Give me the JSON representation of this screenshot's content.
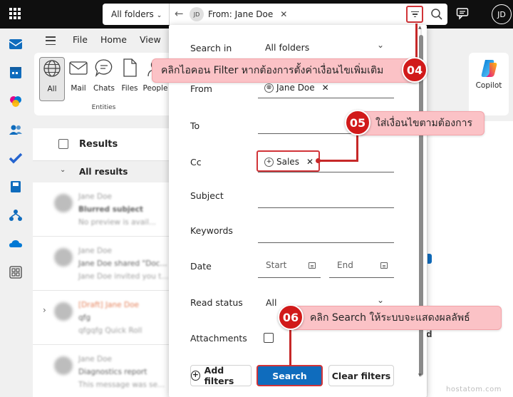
{
  "topbar": {
    "folder_select": "All folders",
    "search_chip": {
      "avatar": "JD",
      "label": "From: Jane Doe"
    },
    "user_avatar": "JD",
    "icons": [
      "waffle-icon",
      "back-arrow-icon",
      "filter-icon",
      "search-icon",
      "chat-icon"
    ]
  },
  "menubar": {
    "items": [
      "File",
      "Home",
      "View"
    ]
  },
  "ribbon": {
    "buttons": [
      {
        "label": "All",
        "icon": "globe-icon",
        "selected": true
      },
      {
        "label": "Mail",
        "icon": "mail-icon"
      },
      {
        "label": "Chats",
        "icon": "chat-bubble-icon"
      },
      {
        "label": "Files",
        "icon": "file-icon"
      },
      {
        "label": "People",
        "icon": "people-icon"
      }
    ],
    "group_label": "Entities",
    "copilot_label": "Copilot"
  },
  "message_list": {
    "results_label": "Results",
    "all_results_label": "All results",
    "items": [
      {
        "sender": "Jane Doe",
        "subject": "Blurred subject",
        "preview": "No preview is avail..."
      },
      {
        "sender": "Jane Doe",
        "subject": "Jane Doe shared \"Doc...",
        "preview": "Jane Doe invited you t..."
      },
      {
        "sender": "[Draft] Jane Doe",
        "subject": "qfg",
        "preview": "qfgqfg Quick Roll"
      },
      {
        "sender": "Jane Doe",
        "subject": "Diagnostics report",
        "preview": "This message was se..."
      }
    ]
  },
  "filter_panel": {
    "search_in": {
      "label": "Search in",
      "value": "All folders"
    },
    "from": {
      "label": "From",
      "pill": "Jane Doe"
    },
    "to": {
      "label": "To"
    },
    "cc": {
      "label": "Cc",
      "pill": "Sales"
    },
    "subject": {
      "label": "Subject"
    },
    "keywords": {
      "label": "Keywords"
    },
    "date": {
      "label": "Date",
      "start_placeholder": "Start",
      "end_placeholder": "End"
    },
    "read_status": {
      "label": "Read status",
      "value": "All"
    },
    "attachments": {
      "label": "Attachments",
      "checked": false
    },
    "buttons": {
      "add_filters": "Add filters",
      "search": "Search",
      "clear_filters": "Clear filters"
    }
  },
  "annotations": [
    {
      "number": "04",
      "text": "คลิกไอคอน Filter หากต้องการตั้งค่าเงื่อนไขเพิ่มเติม"
    },
    {
      "number": "05",
      "text": "ใส่เงื่อนไขตามต้องการ"
    },
    {
      "number": "06",
      "text": "คลิก Search ให้ระบบจะแสดงผลลัพธ์"
    }
  ],
  "right_peek_text": "d",
  "watermark": "hostatom.com",
  "colors": {
    "accent": "#0f6cbd",
    "annotation_red": "#d11a1a",
    "callout_pink": "#fbc2c6"
  }
}
